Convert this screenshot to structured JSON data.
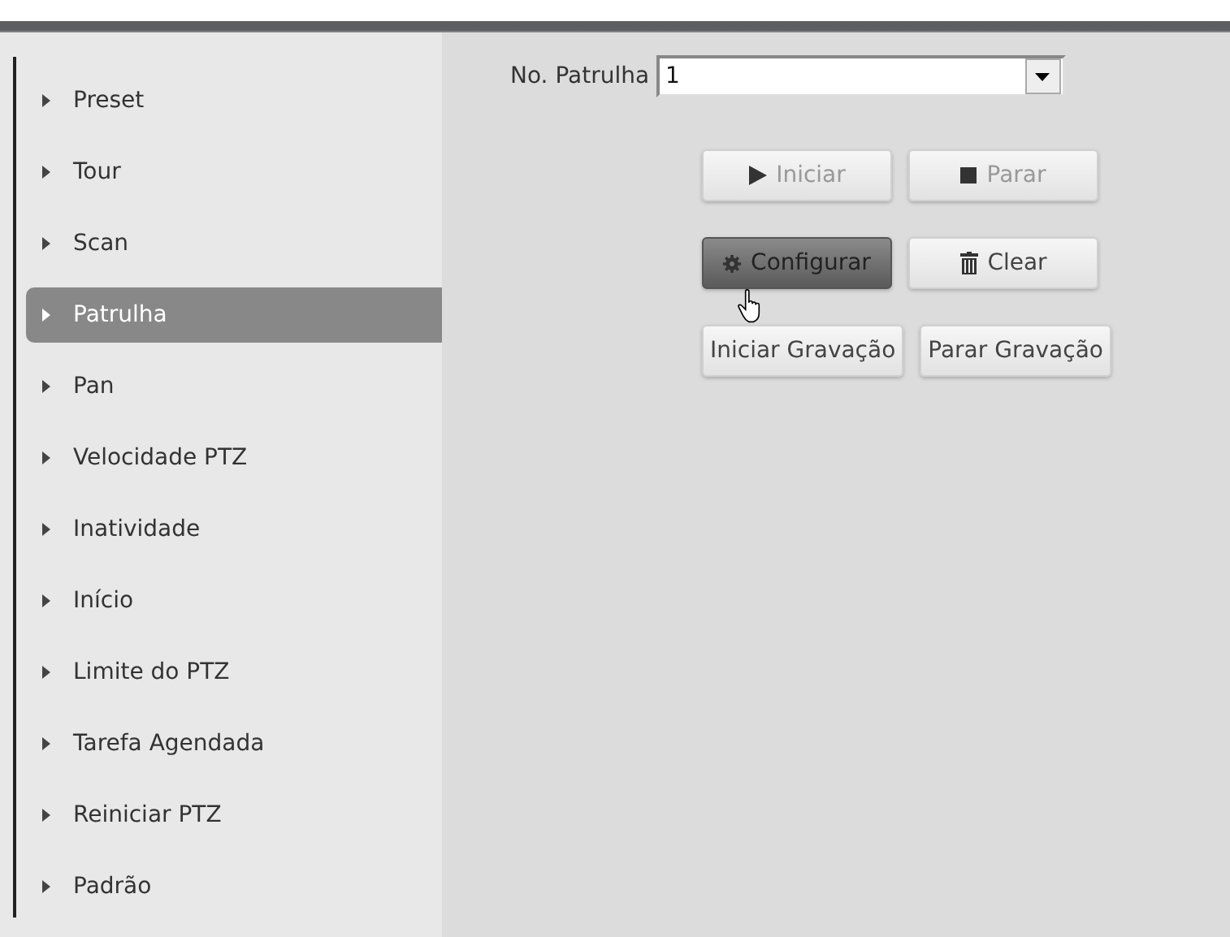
{
  "menu": [
    {
      "label": "Preset",
      "selected": false
    },
    {
      "label": "Tour",
      "selected": false
    },
    {
      "label": "Scan",
      "selected": false
    },
    {
      "label": "Patrulha",
      "selected": true
    },
    {
      "label": "Pan",
      "selected": false
    },
    {
      "label": "Velocidade PTZ",
      "selected": false
    },
    {
      "label": "Inatividade",
      "selected": false
    },
    {
      "label": "Início",
      "selected": false
    },
    {
      "label": "Limite do PTZ",
      "selected": false
    },
    {
      "label": "Tarefa Agendada",
      "selected": false
    },
    {
      "label": "Reiniciar PTZ",
      "selected": false
    },
    {
      "label": "Padrão",
      "selected": false
    }
  ],
  "patrol_select": {
    "label": "No. Patrulha",
    "value": "1"
  },
  "button_rows": [
    [
      {
        "label": "Iniciar",
        "kind": "play",
        "disabled": true,
        "pressed": false
      },
      {
        "label": "Parar",
        "kind": "stop",
        "disabled": true,
        "pressed": false
      }
    ],
    [
      {
        "label": "Configurar",
        "kind": "gear",
        "disabled": false,
        "pressed": true
      },
      {
        "label": "Clear",
        "kind": "trash",
        "disabled": false,
        "pressed": false
      }
    ],
    [
      {
        "label": "Iniciar Gravação",
        "kind": "text",
        "disabled": false,
        "pressed": false
      },
      {
        "label": "Parar Gravação",
        "kind": "text",
        "disabled": false,
        "pressed": false
      }
    ]
  ]
}
